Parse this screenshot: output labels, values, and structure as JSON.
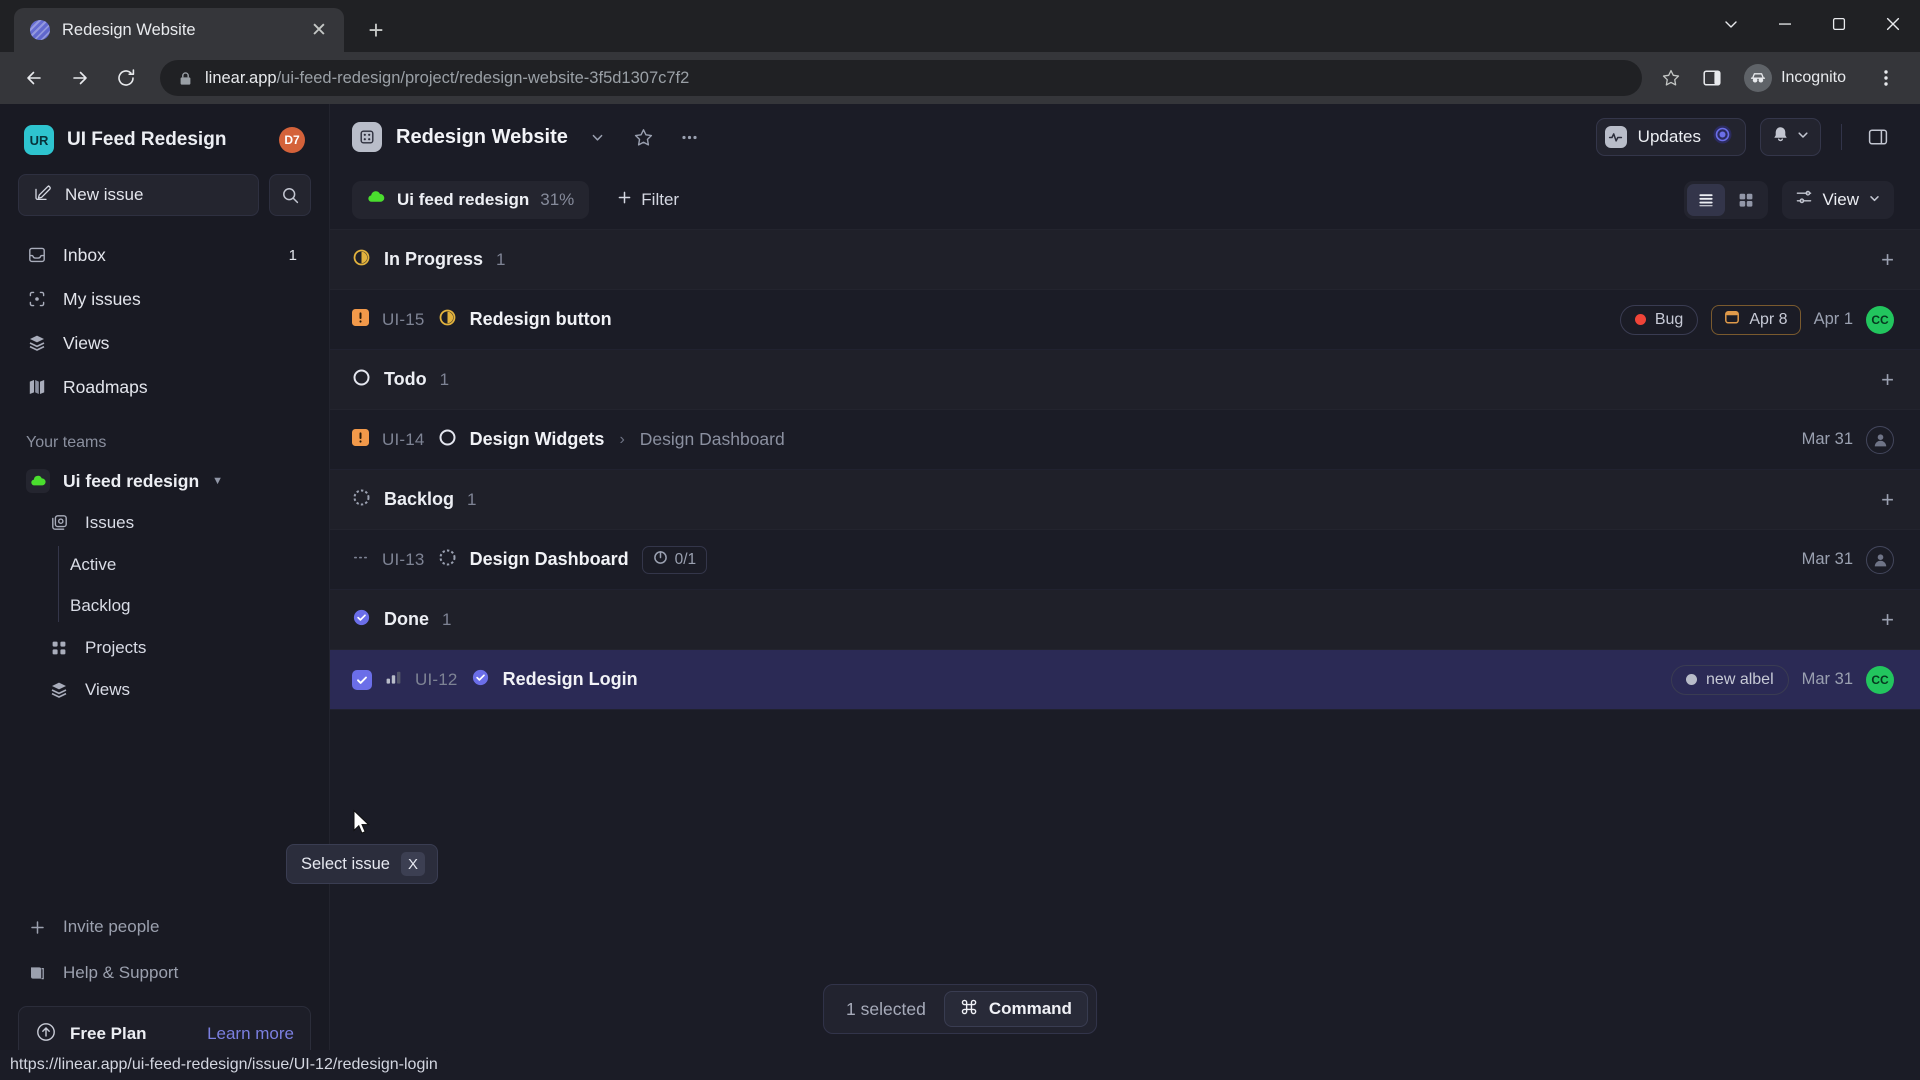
{
  "browser": {
    "tab_title": "Redesign Website",
    "tab_favicon": "linear-logo-icon",
    "url_domain": "linear.app",
    "url_path": "/ui-feed-redesign/project/redesign-website-3f5d1307c7f2",
    "incognito_label": "Incognito",
    "status_bar_url": "https://linear.app/ui-feed-redesign/issue/UI-12/redesign-login"
  },
  "sidebar": {
    "workspace": {
      "badge": "UR",
      "name": "UI Feed Redesign",
      "avatar": "D7",
      "badge_color": "#2ec4cf",
      "avatar_color": "#d4623a"
    },
    "new_issue_label": "New issue",
    "nav": [
      {
        "label": "Inbox",
        "icon": "inbox-icon",
        "badge": "1"
      },
      {
        "label": "My issues",
        "icon": "my-issues-icon",
        "badge": ""
      },
      {
        "label": "Views",
        "icon": "views-icon",
        "badge": ""
      },
      {
        "label": "Roadmaps",
        "icon": "roadmaps-icon",
        "badge": ""
      }
    ],
    "teams_label": "Your teams",
    "team": {
      "name": "Ui feed redesign",
      "icon": "green-cloud-icon"
    },
    "team_nav": [
      {
        "label": "Issues",
        "icon": "issues-icon"
      },
      {
        "label": "Projects",
        "icon": "projects-icon"
      },
      {
        "label": "Views",
        "icon": "views-icon"
      }
    ],
    "issue_children": [
      {
        "label": "Active"
      },
      {
        "label": "Backlog"
      }
    ],
    "bottom": [
      {
        "label": "Invite people",
        "icon": "plus-icon"
      },
      {
        "label": "Help & Support",
        "icon": "book-icon"
      }
    ],
    "plan": {
      "name": "Free Plan",
      "link": "Learn more",
      "icon": "upgrade-arrow-icon"
    }
  },
  "header": {
    "project_title": "Redesign Website",
    "updates_label": "Updates",
    "icons": {
      "star": "star-icon",
      "more": "more-options-icon",
      "bell": "bell-icon",
      "panel": "toggle-panel-icon"
    }
  },
  "filter_bar": {
    "team_chip": {
      "label": "Ui feed redesign",
      "percent": "31%"
    },
    "filter_label": "Filter",
    "view_label": "View",
    "list_view_active": true
  },
  "groups": [
    {
      "name": "In Progress",
      "count": "1",
      "status_icon": "in-progress-icon",
      "status_color": "#e2b23d",
      "issues": [
        {
          "key": "UI-15",
          "title": "Redesign button",
          "parent": "",
          "priority_icon": "urgent-priority-icon",
          "status_icon": "in-progress-icon",
          "status_color": "#e2b23d",
          "label": {
            "text": "Bug",
            "color": "#f04438"
          },
          "due_date": "Apr 8",
          "date": "Apr 1",
          "avatar": {
            "initials": "CC",
            "color": "#22c55e"
          },
          "sub_count": ""
        }
      ]
    },
    {
      "name": "Todo",
      "count": "1",
      "status_icon": "todo-icon",
      "status_color": "#e4e6ef",
      "issues": [
        {
          "key": "UI-14",
          "title": "Design Widgets",
          "parent": "Design Dashboard",
          "priority_icon": "urgent-priority-icon",
          "status_icon": "todo-icon",
          "status_color": "#e4e6ef",
          "label": null,
          "due_date": "",
          "date": "Mar 31",
          "avatar": null,
          "sub_count": ""
        }
      ]
    },
    {
      "name": "Backlog",
      "count": "1",
      "status_icon": "backlog-icon",
      "status_color": "#9aa0b0",
      "issues": [
        {
          "key": "UI-13",
          "title": "Design Dashboard",
          "parent": "",
          "priority_icon": "no-priority-icon",
          "status_icon": "backlog-icon",
          "status_color": "#9aa0b0",
          "label": null,
          "due_date": "",
          "date": "Mar 31",
          "avatar": null,
          "sub_count": "0/1"
        }
      ]
    },
    {
      "name": "Done",
      "count": "1",
      "status_icon": "done-icon",
      "status_color": "#6b6ee8",
      "issues": [
        {
          "key": "UI-12",
          "title": "Redesign Login",
          "parent": "",
          "priority_icon": "medium-priority-icon",
          "status_icon": "done-icon",
          "status_color": "#6b6ee8",
          "label": {
            "text": "new albel",
            "color": "#b8bcc9"
          },
          "due_date": "",
          "date": "Mar 31",
          "avatar": {
            "initials": "CC",
            "color": "#22c55e"
          },
          "sub_count": "",
          "selected": true
        }
      ]
    }
  ],
  "tooltip": {
    "text": "Select issue",
    "key": "X"
  },
  "action_bar": {
    "selected_text": "1 selected",
    "command_label": "Command",
    "command_icon": "command-key-icon"
  },
  "colors": {
    "accent": "#6b6ee8",
    "selected_row": "#2b2a55",
    "app_bg": "#1b1c26",
    "sidebar_bg": "#191a23"
  }
}
